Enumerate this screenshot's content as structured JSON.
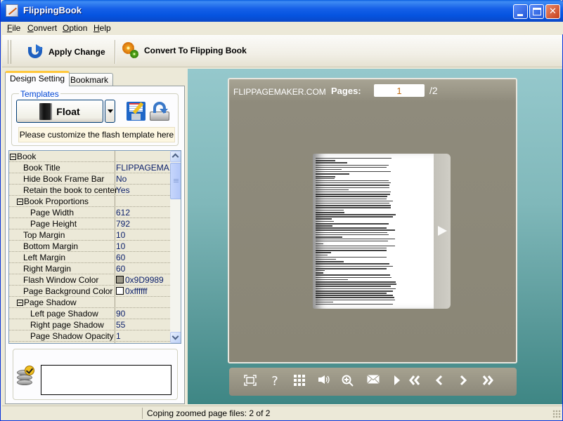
{
  "window": {
    "title": "FlippingBook",
    "controls": [
      "minimize",
      "maximize",
      "close"
    ]
  },
  "menu": {
    "items": [
      {
        "label": "File",
        "accel": "F"
      },
      {
        "label": "Convert",
        "accel": "C"
      },
      {
        "label": "Option",
        "accel": "O"
      },
      {
        "label": "Help",
        "accel": "H"
      }
    ]
  },
  "toolbar": {
    "apply_label": "Apply Change",
    "convert_label": "Convert To Flipping Book",
    "apply_icon": "apply-refresh-icon",
    "convert_icon": "gears-icon"
  },
  "left_panel": {
    "tabs": [
      {
        "label": "Design Setting",
        "active": true
      },
      {
        "label": "Bookmark",
        "active": false
      }
    ],
    "templates": {
      "group_label": "Templates",
      "selected": "Float",
      "hint": "Please customize the flash template here"
    },
    "properties": [
      {
        "name": "Book",
        "value": "",
        "level": 0,
        "group": true
      },
      {
        "name": "Book Title",
        "value": "FLIPPAGEMA...",
        "level": 1
      },
      {
        "name": "Hide Book Frame Bar",
        "value": "No",
        "level": 1
      },
      {
        "name": "Retain the book to center",
        "value": "Yes",
        "level": 1
      },
      {
        "name": "Book Proportions",
        "value": "",
        "level": 1,
        "group": true
      },
      {
        "name": "Page Width",
        "value": "612",
        "level": 2
      },
      {
        "name": "Page Height",
        "value": "792",
        "level": 2
      },
      {
        "name": "Top Margin",
        "value": "10",
        "level": 1
      },
      {
        "name": "Bottom Margin",
        "value": "10",
        "level": 1
      },
      {
        "name": "Left Margin",
        "value": "60",
        "level": 1
      },
      {
        "name": "Right Margin",
        "value": "60",
        "level": 1
      },
      {
        "name": "Flash Window Color",
        "value": "0x9D9989",
        "level": 1,
        "swatch": "#9D9989"
      },
      {
        "name": "Page Background Color",
        "value": "0xffffff",
        "level": 1,
        "swatch": "#ffffff"
      },
      {
        "name": "Page Shadow",
        "value": "",
        "level": 1,
        "group": true
      },
      {
        "name": "Left page Shadow",
        "value": "90",
        "level": 2
      },
      {
        "name": "Right page Shadow",
        "value": "55",
        "level": 2
      },
      {
        "name": "Page Shadow Opacity",
        "value": "1",
        "level": 2
      }
    ],
    "status_box_text": ""
  },
  "preview": {
    "site_label": "FLIPPAGEMAKER.COM",
    "pages_label": "Pages:",
    "current_page": "1",
    "total_pages": "/2",
    "controls": [
      {
        "name": "fullscreen",
        "icon": "fullscreen-icon"
      },
      {
        "name": "help",
        "icon": "help-icon"
      },
      {
        "name": "thumbnails",
        "icon": "grid-icon"
      },
      {
        "name": "sound",
        "icon": "speaker-icon"
      },
      {
        "name": "zoom",
        "icon": "zoom-in-icon"
      },
      {
        "name": "email",
        "icon": "envelope-icon"
      },
      {
        "name": "autoplay",
        "icon": "play-icon"
      },
      {
        "name": "first",
        "icon": "first-page-icon"
      },
      {
        "name": "previous",
        "icon": "previous-page-icon"
      },
      {
        "name": "next",
        "icon": "next-page-icon"
      },
      {
        "name": "last",
        "icon": "last-page-icon"
      }
    ],
    "colors": {
      "frame": "#9D9989",
      "page": "#ffffff"
    }
  },
  "statusbar": {
    "text": "Coping zoomed page files: 2 of 2"
  }
}
